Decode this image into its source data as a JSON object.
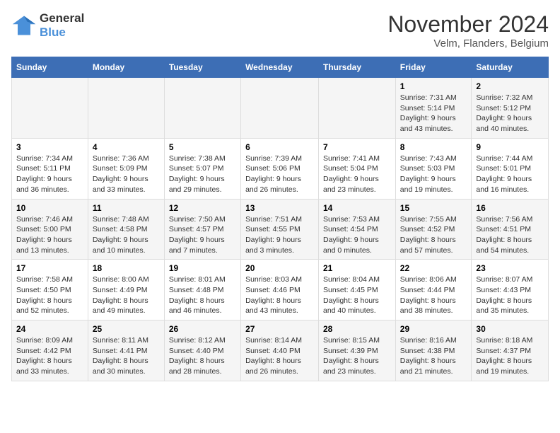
{
  "logo": {
    "line1": "General",
    "line2": "Blue"
  },
  "title": "November 2024",
  "location": "Velm, Flanders, Belgium",
  "weekdays": [
    "Sunday",
    "Monday",
    "Tuesday",
    "Wednesday",
    "Thursday",
    "Friday",
    "Saturday"
  ],
  "rows": [
    [
      {
        "day": "",
        "info": ""
      },
      {
        "day": "",
        "info": ""
      },
      {
        "day": "",
        "info": ""
      },
      {
        "day": "",
        "info": ""
      },
      {
        "day": "",
        "info": ""
      },
      {
        "day": "1",
        "info": "Sunrise: 7:31 AM\nSunset: 5:14 PM\nDaylight: 9 hours and 43 minutes."
      },
      {
        "day": "2",
        "info": "Sunrise: 7:32 AM\nSunset: 5:12 PM\nDaylight: 9 hours and 40 minutes."
      }
    ],
    [
      {
        "day": "3",
        "info": "Sunrise: 7:34 AM\nSunset: 5:11 PM\nDaylight: 9 hours and 36 minutes."
      },
      {
        "day": "4",
        "info": "Sunrise: 7:36 AM\nSunset: 5:09 PM\nDaylight: 9 hours and 33 minutes."
      },
      {
        "day": "5",
        "info": "Sunrise: 7:38 AM\nSunset: 5:07 PM\nDaylight: 9 hours and 29 minutes."
      },
      {
        "day": "6",
        "info": "Sunrise: 7:39 AM\nSunset: 5:06 PM\nDaylight: 9 hours and 26 minutes."
      },
      {
        "day": "7",
        "info": "Sunrise: 7:41 AM\nSunset: 5:04 PM\nDaylight: 9 hours and 23 minutes."
      },
      {
        "day": "8",
        "info": "Sunrise: 7:43 AM\nSunset: 5:03 PM\nDaylight: 9 hours and 19 minutes."
      },
      {
        "day": "9",
        "info": "Sunrise: 7:44 AM\nSunset: 5:01 PM\nDaylight: 9 hours and 16 minutes."
      }
    ],
    [
      {
        "day": "10",
        "info": "Sunrise: 7:46 AM\nSunset: 5:00 PM\nDaylight: 9 hours and 13 minutes."
      },
      {
        "day": "11",
        "info": "Sunrise: 7:48 AM\nSunset: 4:58 PM\nDaylight: 9 hours and 10 minutes."
      },
      {
        "day": "12",
        "info": "Sunrise: 7:50 AM\nSunset: 4:57 PM\nDaylight: 9 hours and 7 minutes."
      },
      {
        "day": "13",
        "info": "Sunrise: 7:51 AM\nSunset: 4:55 PM\nDaylight: 9 hours and 3 minutes."
      },
      {
        "day": "14",
        "info": "Sunrise: 7:53 AM\nSunset: 4:54 PM\nDaylight: 9 hours and 0 minutes."
      },
      {
        "day": "15",
        "info": "Sunrise: 7:55 AM\nSunset: 4:52 PM\nDaylight: 8 hours and 57 minutes."
      },
      {
        "day": "16",
        "info": "Sunrise: 7:56 AM\nSunset: 4:51 PM\nDaylight: 8 hours and 54 minutes."
      }
    ],
    [
      {
        "day": "17",
        "info": "Sunrise: 7:58 AM\nSunset: 4:50 PM\nDaylight: 8 hours and 52 minutes."
      },
      {
        "day": "18",
        "info": "Sunrise: 8:00 AM\nSunset: 4:49 PM\nDaylight: 8 hours and 49 minutes."
      },
      {
        "day": "19",
        "info": "Sunrise: 8:01 AM\nSunset: 4:48 PM\nDaylight: 8 hours and 46 minutes."
      },
      {
        "day": "20",
        "info": "Sunrise: 8:03 AM\nSunset: 4:46 PM\nDaylight: 8 hours and 43 minutes."
      },
      {
        "day": "21",
        "info": "Sunrise: 8:04 AM\nSunset: 4:45 PM\nDaylight: 8 hours and 40 minutes."
      },
      {
        "day": "22",
        "info": "Sunrise: 8:06 AM\nSunset: 4:44 PM\nDaylight: 8 hours and 38 minutes."
      },
      {
        "day": "23",
        "info": "Sunrise: 8:07 AM\nSunset: 4:43 PM\nDaylight: 8 hours and 35 minutes."
      }
    ],
    [
      {
        "day": "24",
        "info": "Sunrise: 8:09 AM\nSunset: 4:42 PM\nDaylight: 8 hours and 33 minutes."
      },
      {
        "day": "25",
        "info": "Sunrise: 8:11 AM\nSunset: 4:41 PM\nDaylight: 8 hours and 30 minutes."
      },
      {
        "day": "26",
        "info": "Sunrise: 8:12 AM\nSunset: 4:40 PM\nDaylight: 8 hours and 28 minutes."
      },
      {
        "day": "27",
        "info": "Sunrise: 8:14 AM\nSunset: 4:40 PM\nDaylight: 8 hours and 26 minutes."
      },
      {
        "day": "28",
        "info": "Sunrise: 8:15 AM\nSunset: 4:39 PM\nDaylight: 8 hours and 23 minutes."
      },
      {
        "day": "29",
        "info": "Sunrise: 8:16 AM\nSunset: 4:38 PM\nDaylight: 8 hours and 21 minutes."
      },
      {
        "day": "30",
        "info": "Sunrise: 8:18 AM\nSunset: 4:37 PM\nDaylight: 8 hours and 19 minutes."
      }
    ]
  ]
}
